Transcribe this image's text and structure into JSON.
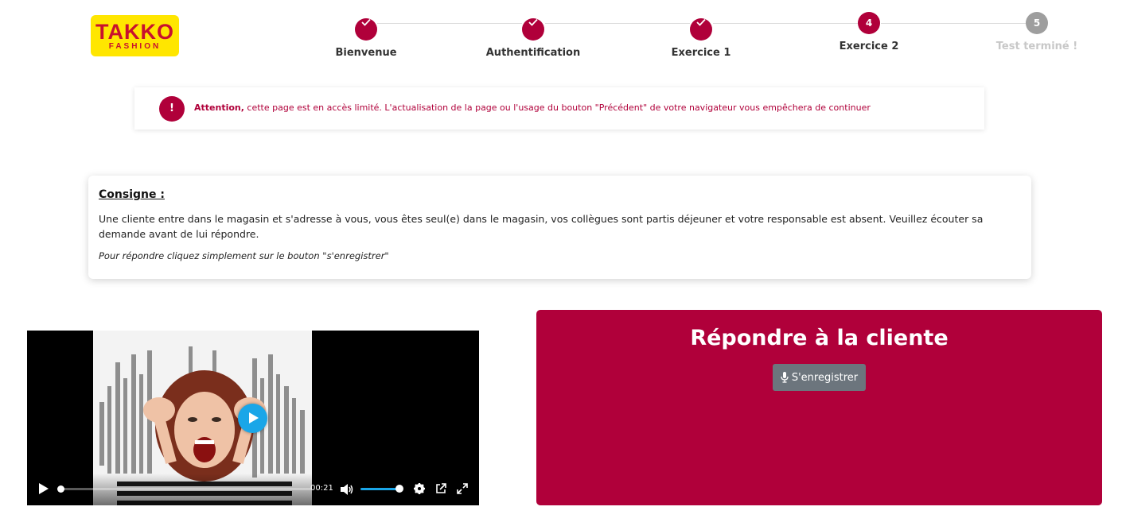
{
  "logo": {
    "brand": "TAKKO",
    "sub": "FASHION"
  },
  "stepper": {
    "steps": [
      {
        "label": "Bienvenue",
        "state": "done",
        "icon": "check-icon"
      },
      {
        "label": "Authentification",
        "state": "done",
        "icon": "check-icon"
      },
      {
        "label": "Exercice 1",
        "state": "done",
        "icon": "check-icon"
      },
      {
        "label": "Exercice 2",
        "state": "current",
        "number": "4"
      },
      {
        "label": "Test terminé !",
        "state": "pending",
        "number": "5"
      }
    ]
  },
  "alert": {
    "icon": "!",
    "strong": "Attention,",
    "text": " cette page est en accès limité. L'actualisation de la page ou l'usage du bouton \"Précédent\" de votre navigateur vous empêchera de continuer"
  },
  "instructions": {
    "title": "Consigne :",
    "body": "Une cliente entre dans le magasin et s'adresse à vous, vous êtes seul(e) dans le magasin, vos collègues sont partis déjeuner et votre responsable est absent. Veuillez écouter sa demande avant de lui répondre.",
    "hint": "Pour répondre cliquez simplement sur le bouton \"s'enregistrer\""
  },
  "video": {
    "time": "00:21",
    "progress": 0.0,
    "volume": 1.0,
    "icons": [
      "play-icon",
      "volume-icon",
      "settings-icon",
      "popout-icon",
      "fullscreen-icon"
    ]
  },
  "answer": {
    "title": "Répondre à la cliente",
    "record_label": "S'enregistrer",
    "record_icon": "microphone-icon"
  },
  "colors": {
    "accent": "#b0003a",
    "pending": "#9e9e9e",
    "logo_bg": "#ffe600",
    "logo_text": "#c8102e",
    "video_accent": "#1aa6e8"
  }
}
